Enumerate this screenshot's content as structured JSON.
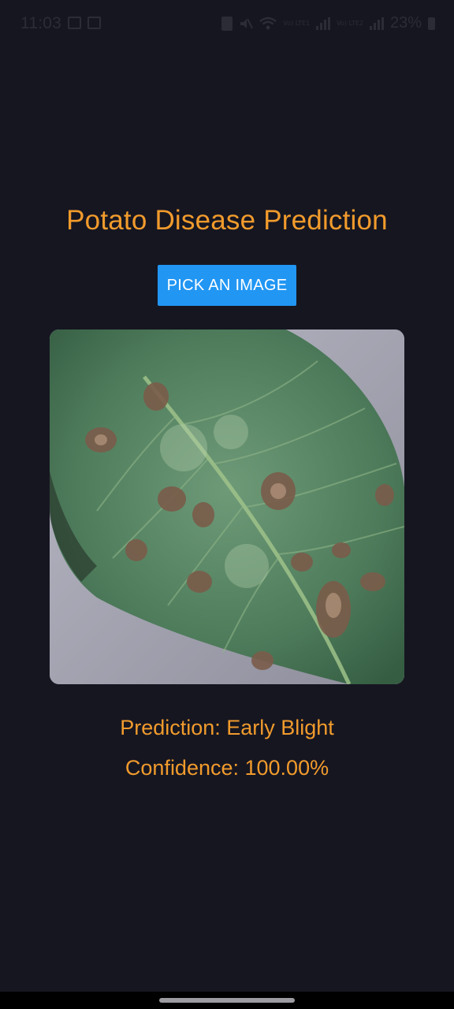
{
  "status_bar": {
    "time": "11:03",
    "battery": "23%",
    "network_label_1": "Vo) LTE1",
    "network_label_2": "Vo) LTE2",
    "icons": [
      "gallery-icon",
      "calendar-icon",
      "battery-saver-icon",
      "mute-icon",
      "wifi-icon",
      "signal-icon",
      "signal-icon",
      "battery-icon"
    ]
  },
  "app": {
    "title": "Potato Disease Prediction",
    "pick_button_label": "PICK AN IMAGE",
    "image_alt": "potato leaf photo",
    "prediction_text": "Prediction: Early Blight",
    "confidence_text": "Confidence: 100.00%"
  },
  "colors": {
    "background": "#161621",
    "accent_text": "#f19b2c",
    "button": "#2196f3"
  }
}
